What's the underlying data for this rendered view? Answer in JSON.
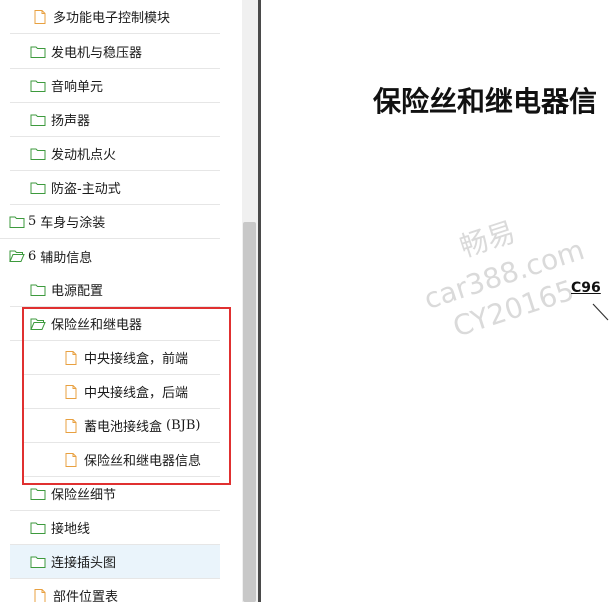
{
  "tree": {
    "items": [
      {
        "label": "多功能电子控制模块",
        "icon": "document-icon"
      },
      {
        "label": "发电机与稳压器",
        "icon": "folder-icon"
      },
      {
        "label": "音响单元",
        "icon": "folder-icon"
      },
      {
        "label": "扬声器",
        "icon": "folder-icon"
      },
      {
        "label": "发动机点火",
        "icon": "folder-icon"
      },
      {
        "label": "防盗-主动式",
        "icon": "folder-icon"
      },
      {
        "num": "5",
        "label": "车身与涂装",
        "icon": "folder-icon"
      },
      {
        "num": "6",
        "label": "辅助信息",
        "icon": "folder-open-icon"
      },
      {
        "label": "电源配置",
        "icon": "folder-icon"
      },
      {
        "label": "保险丝和继电器",
        "icon": "folder-open-icon"
      },
      {
        "label": "中央接线盒，前端",
        "icon": "document-icon"
      },
      {
        "label": "中央接线盒，后端",
        "icon": "document-icon"
      },
      {
        "label": "蓄电池接线盒",
        "suffix": "(BJB)",
        "icon": "document-icon"
      },
      {
        "label": "保险丝和继电器信息",
        "icon": "document-icon"
      },
      {
        "label": "保险丝细节",
        "icon": "folder-icon"
      },
      {
        "label": "接地线",
        "icon": "folder-icon"
      },
      {
        "label": "连接插头图",
        "icon": "folder-icon"
      },
      {
        "label": "部件位置表",
        "icon": "document-icon"
      }
    ]
  },
  "document": {
    "title": "保险丝和继电器信",
    "connector_label": "C96",
    "watermark": {
      "line1": "畅易",
      "line2": "car388.com",
      "line3": "CY20165"
    }
  },
  "colors": {
    "folder": "#3d9a3d",
    "document": "#e8a040",
    "selected_bg": "#eaf4fb",
    "highlight": "#e03030"
  }
}
